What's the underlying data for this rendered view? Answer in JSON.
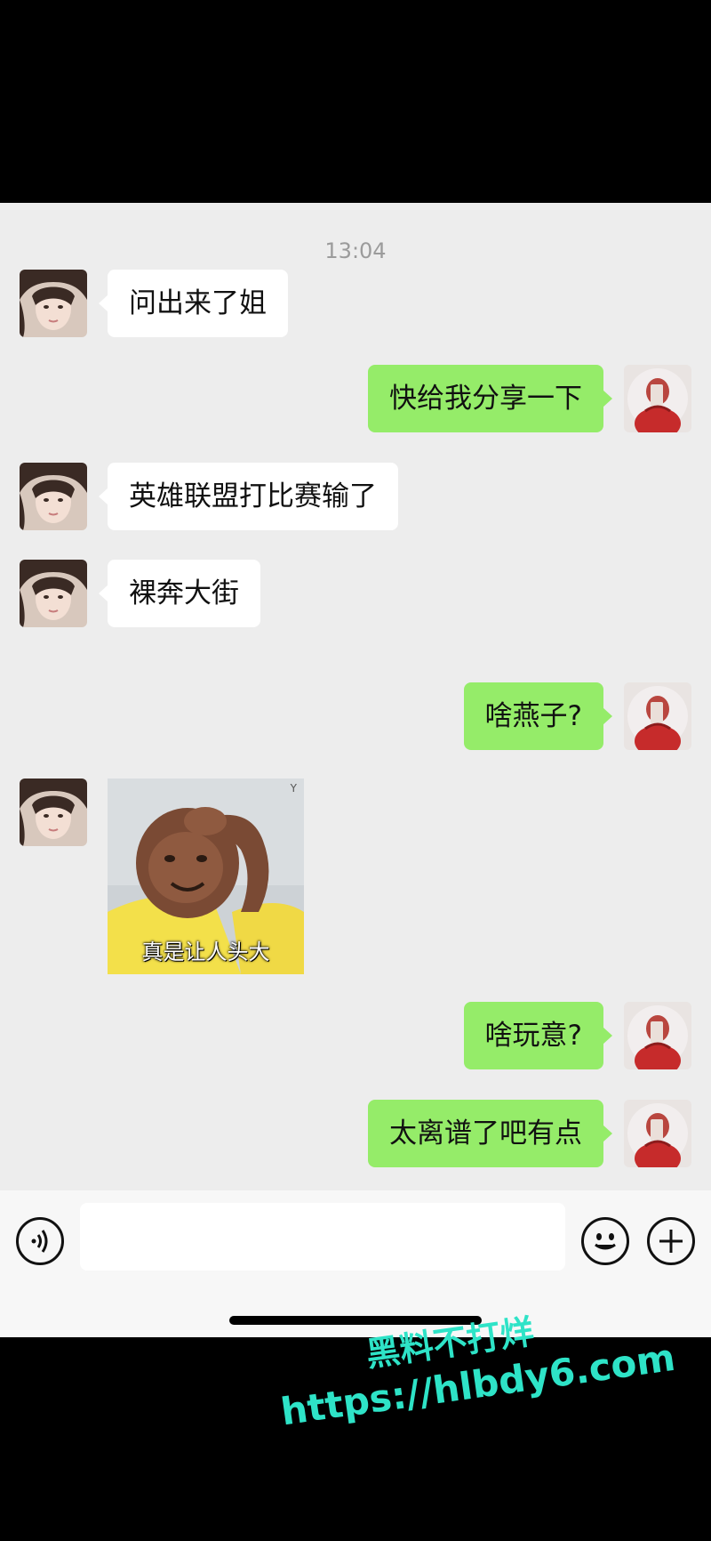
{
  "chat": {
    "timestamp": "13:04",
    "messages": [
      {
        "side": "in",
        "text": "问出来了姐"
      },
      {
        "side": "out",
        "text": "快给我分享一下"
      },
      {
        "side": "in",
        "text": "英雄联盟打比赛输了"
      },
      {
        "side": "in",
        "text": "裸奔大街"
      },
      {
        "side": "out",
        "text": "啥燕子?"
      },
      {
        "side": "in",
        "sticker_caption": "真是让人头大",
        "sticker_mark": "Y"
      },
      {
        "side": "out",
        "text": "啥玩意?"
      },
      {
        "side": "out",
        "text": "太离谱了吧有点"
      }
    ]
  },
  "input_bar": {
    "voice_icon": "voice-icon",
    "emoji_icon": "emoji-icon",
    "plus_icon": "plus-icon",
    "input_value": ""
  },
  "watermark": {
    "title": "黑料不打烊",
    "url": "https://hlbdy6.com"
  },
  "colors": {
    "chat_bg": "#ededed",
    "incoming_bubble": "#ffffff",
    "outgoing_bubble": "#95ec69",
    "watermark": "#2ee3c7"
  }
}
